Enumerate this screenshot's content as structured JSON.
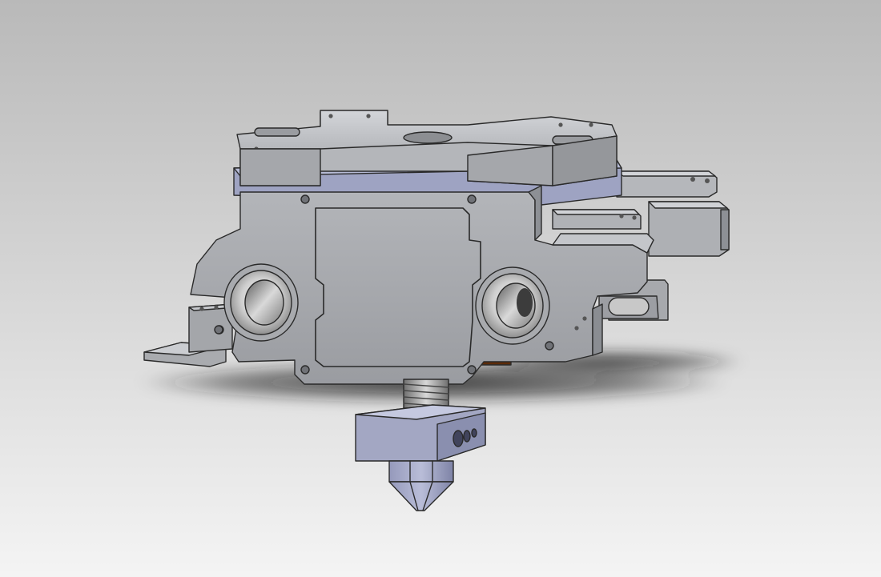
{
  "scene": {
    "subject": "3d-printer-extruder-hotend-assembly",
    "colors": {
      "background_top": "#b9b9b9",
      "background_bottom": "#f4f4f4",
      "frame": "#a6a8ac",
      "frame_light": "#c9cbcf",
      "frame_dark": "#7d8085",
      "outline": "#2a2a2a",
      "plate_blue": "#9da3c2",
      "plate_blue_dark": "#6e7496",
      "gear_blue": "#aeb3d3",
      "heater_brown": "#7a3f14",
      "heater_brown_dark": "#4a2206",
      "bearing_outer": "#e2e2e2",
      "bearing_inner": "#8d8d8d",
      "nozzle_block": "#a4a8c4",
      "nozzle_tip": "#8a8fb0",
      "shadow": "#1c1c1c"
    }
  }
}
